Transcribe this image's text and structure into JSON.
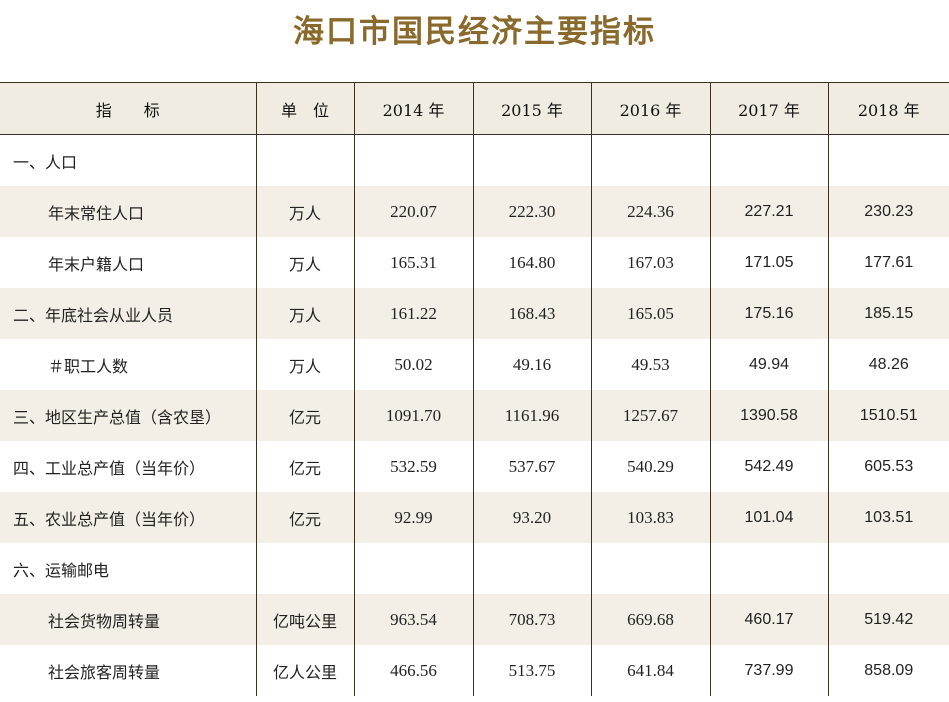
{
  "title": "海口市国民经济主要指标",
  "header": {
    "indicator": "指　　标",
    "unit": "单　位",
    "years": [
      "2014 年",
      "2015 年",
      "2016 年",
      "2017 年",
      "2018 年"
    ]
  },
  "rows": [
    {
      "label": "一、人口",
      "level": 1,
      "unit": "",
      "values": [
        "",
        "",
        "",
        "",
        ""
      ]
    },
    {
      "label": "年末常住人口",
      "level": 2,
      "unit": "万人",
      "values": [
        "220.07",
        "222.30",
        "224.36",
        "227.21",
        "230.23"
      ]
    },
    {
      "label": "年末户籍人口",
      "level": 2,
      "unit": "万人",
      "values": [
        "165.31",
        "164.80",
        "167.03",
        "171.05",
        "177.61"
      ]
    },
    {
      "label": "二、年底社会从业人员",
      "level": 1,
      "unit": "万人",
      "values": [
        "161.22",
        "168.43",
        "165.05",
        "175.16",
        "185.15"
      ]
    },
    {
      "label": "＃职工人数",
      "level": 2,
      "unit": "万人",
      "values": [
        "50.02",
        "49.16",
        "49.53",
        "49.94",
        "48.26"
      ]
    },
    {
      "label": "三、地区生产总值（含农垦）",
      "level": 1,
      "unit": "亿元",
      "values": [
        "1091.70",
        "1161.96",
        "1257.67",
        "1390.58",
        "1510.51"
      ]
    },
    {
      "label": "四、工业总产值（当年价）",
      "level": 1,
      "unit": "亿元",
      "values": [
        "532.59",
        "537.67",
        "540.29",
        "542.49",
        "605.53"
      ]
    },
    {
      "label": "五、农业总产值（当年价）",
      "level": 1,
      "unit": "亿元",
      "values": [
        "92.99",
        "93.20",
        "103.83",
        "101.04",
        "103.51"
      ]
    },
    {
      "label": "六、运输邮电",
      "level": 1,
      "unit": "",
      "values": [
        "",
        "",
        "",
        "",
        ""
      ]
    },
    {
      "label": "社会货物周转量",
      "level": 2,
      "unit": "亿吨公里",
      "values": [
        "963.54",
        "708.73",
        "669.68",
        "460.17",
        "519.42"
      ]
    },
    {
      "label": "社会旅客周转量",
      "level": 2,
      "unit": "亿人公里",
      "values": [
        "466.56",
        "513.75",
        "641.84",
        "737.99",
        "858.09"
      ]
    }
  ]
}
